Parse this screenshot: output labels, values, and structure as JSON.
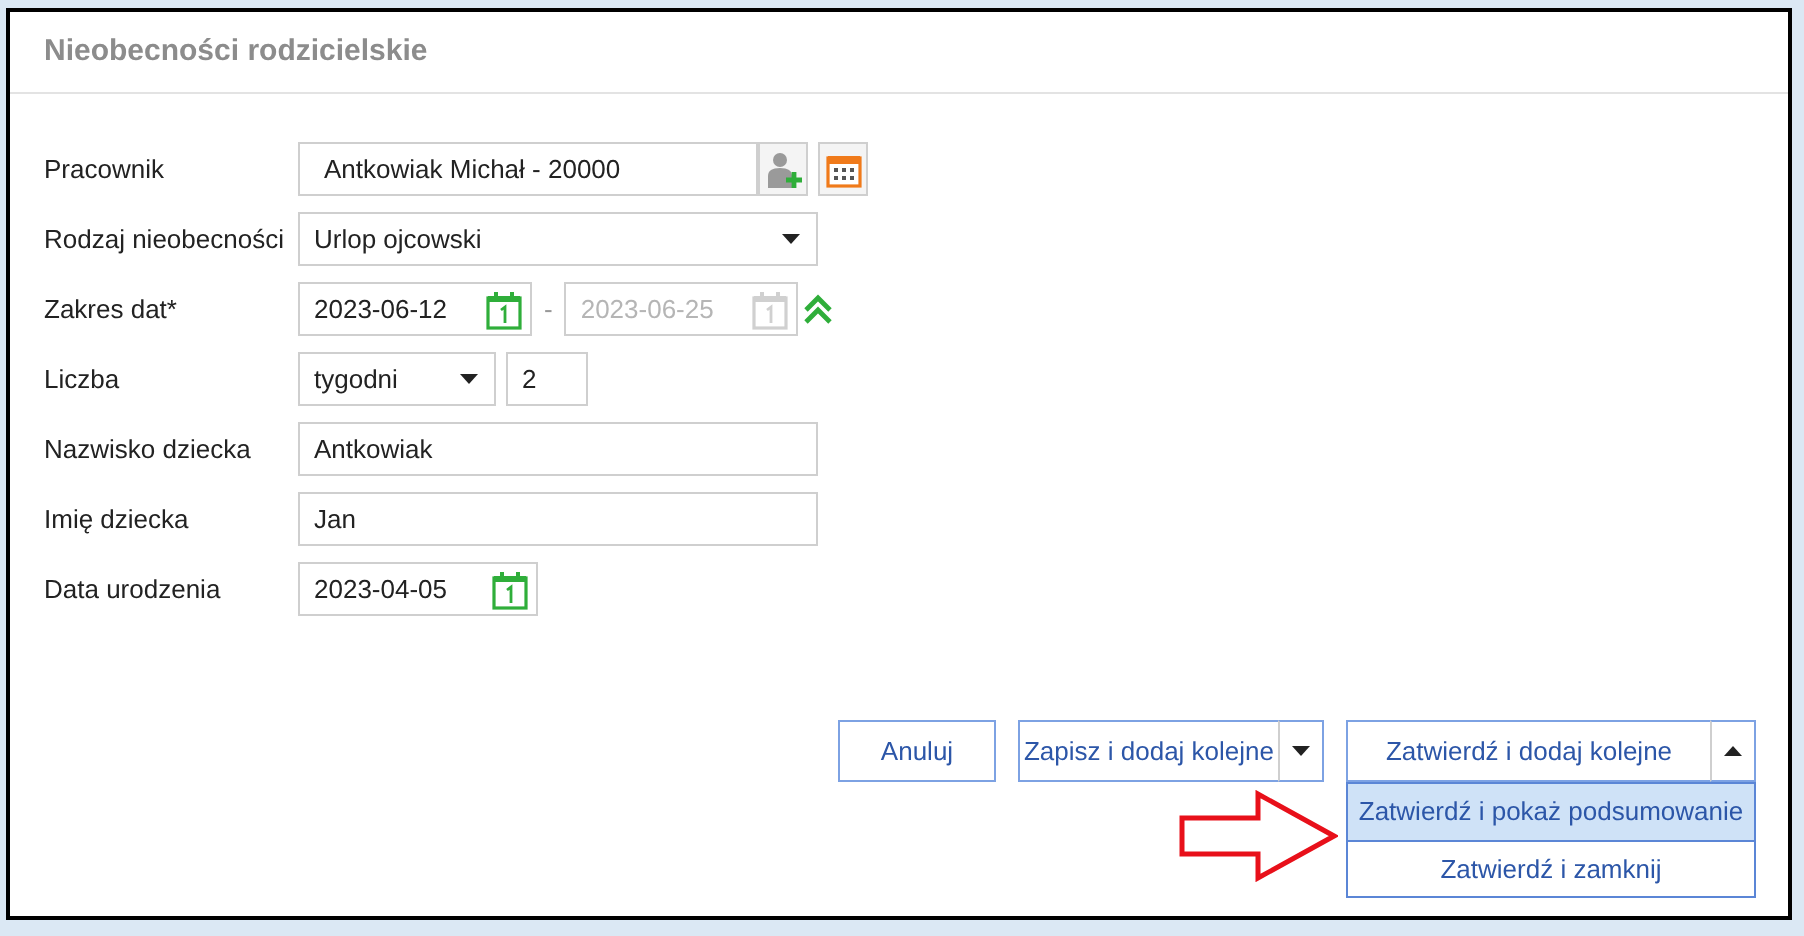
{
  "dialog": {
    "title": "Nieobecności rodzicielskie"
  },
  "fields": [
    {
      "kind": "employee",
      "label": "Pracownik",
      "value": "Antkowiak Michał - 20000"
    },
    {
      "kind": "select",
      "label": "Rodzaj nieobecności",
      "value": "Urlop ojcowski"
    },
    {
      "kind": "date_range",
      "label": "Zakres dat*",
      "from": "2023-06-12",
      "separator": "-",
      "to": "2023-06-25",
      "to_disabled": true
    },
    {
      "kind": "count",
      "label": "Liczba",
      "unit": "tygodni",
      "value": "2"
    },
    {
      "kind": "text",
      "label": "Nazwisko dziecka",
      "value": "Antkowiak"
    },
    {
      "kind": "text",
      "label": "Imię dziecka",
      "value": "Jan"
    },
    {
      "kind": "date",
      "label": "Data urodzenia",
      "value": "2023-04-05"
    }
  ],
  "buttons": [
    {
      "kind": "plain",
      "label": "Anuluj"
    },
    {
      "kind": "split",
      "label": "Zapisz i dodaj kolejne",
      "expanded": false
    },
    {
      "kind": "split",
      "label": "Zatwierdź i dodaj kolejne",
      "expanded": true
    }
  ],
  "dropdown_menu": [
    {
      "label": "Zatwierdź i pokaż podsumowanie",
      "selected": true
    },
    {
      "label": "Zatwierdź i zamknij",
      "selected": false
    }
  ]
}
